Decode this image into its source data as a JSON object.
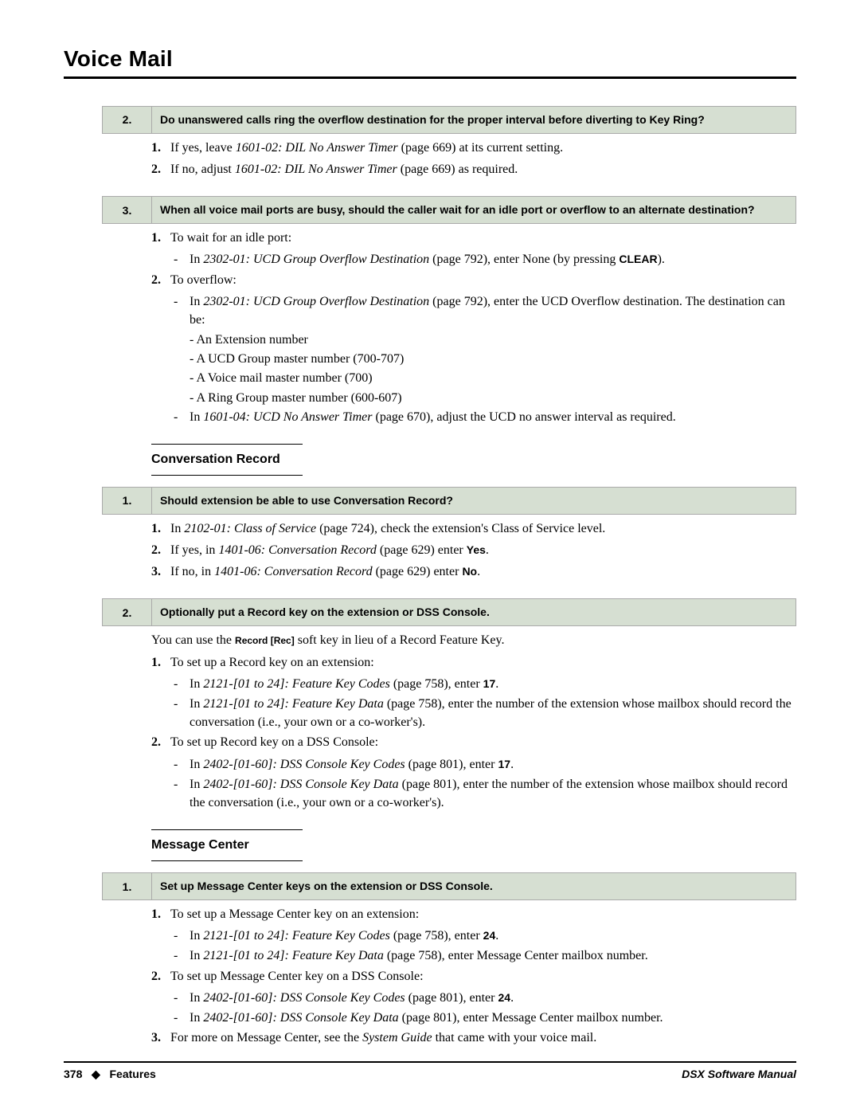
{
  "title": "Voice Mail",
  "q2": {
    "num": "2.",
    "text": "Do unanswered calls ring the overflow destination for the proper interval before diverting to Key Ring?",
    "a1num": "1.",
    "a1a": "If yes, leave ",
    "a1b": "1601-02: DIL No Answer Timer",
    "a1c": " (page 669) at its current setting.",
    "a2num": "2.",
    "a2a": "If no, adjust ",
    "a2b": "1601-02: DIL No Answer Timer",
    "a2c": " (page 669) as required."
  },
  "q3": {
    "num": "3.",
    "text": "When all voice mail ports are busy, should the caller wait for an idle port or overflow to an alternate destination?",
    "a1num": "1.",
    "a1": "To wait for an idle port:",
    "a1s1a": "In ",
    "a1s1b": "2302-01: UCD Group Overflow Destination",
    "a1s1c": " (page 792), enter None (by pressing ",
    "a1s1d": "CLEAR",
    "a1s1e": ").",
    "a2num": "2.",
    "a2": "To overflow:",
    "a2s1a": "In ",
    "a2s1b": "2302-01: UCD Group Overflow Destination",
    "a2s1c": " (page 792), enter the UCD Overflow destination. The destination can be:",
    "a2s1_1": "- An Extension number",
    "a2s1_2": "- A UCD Group master number (700-707)",
    "a2s1_3": "- A Voice mail master number (700)",
    "a2s1_4": "- A Ring Group master number (600-607)",
    "a2s2a": "In ",
    "a2s2b": "1601-04: UCD No Answer Timer",
    "a2s2c": " (page 670), adjust the UCD no answer interval as required."
  },
  "sec1": {
    "title": "Conversation Record"
  },
  "cr1": {
    "num": "1.",
    "text": "Should extension be able to use Conversation Record?",
    "a1num": "1.",
    "a1a": "In ",
    "a1b": "2102-01: Class of Service",
    "a1c": " (page 724), check the extension's Class of Service level.",
    "a2num": "2.",
    "a2a": "If yes, in ",
    "a2b": "1401-06: Conversation Record",
    "a2c": " (page 629) enter ",
    "a2d": "Yes",
    "a2e": ".",
    "a3num": "3.",
    "a3a": "If no, in ",
    "a3b": "1401-06: Conversation Record",
    "a3c": " (page 629) enter ",
    "a3d": "No",
    "a3e": "."
  },
  "cr2": {
    "num": "2.",
    "text": "Optionally put a Record key on the extension or DSS Console.",
    "introa": "You can use the ",
    "introb": "Record [Rec]",
    "introc": " soft key in lieu of a Record Feature Key.",
    "a1num": "1.",
    "a1": "To set up a Record key on an extension:",
    "a1s1a": "In ",
    "a1s1b": "2121-[01 to 24]: Feature Key Codes",
    "a1s1c": " (page 758), enter ",
    "a1s1d": "17",
    "a1s1e": ".",
    "a1s2a": "In ",
    "a1s2b": "2121-[01 to 24]: Feature Key Data",
    "a1s2c": " (page 758), enter the number of the extension whose mailbox should record the conversation (i.e., your own or a co-worker's).",
    "a2num": "2.",
    "a2": "To set up Record key on a DSS Console:",
    "a2s1a": "In ",
    "a2s1b": "2402-[01-60]: DSS Console Key Codes",
    "a2s1c": " (page 801), enter ",
    "a2s1d": "17",
    "a2s1e": ".",
    "a2s2a": "In ",
    "a2s2b": "2402-[01-60]: DSS Console Key Data",
    "a2s2c": " (page 801), enter the number of the extension whose mailbox should record the conversation (i.e., your own or a co-worker's)."
  },
  "sec2": {
    "title": "Message Center"
  },
  "mc1": {
    "num": "1.",
    "text": "Set up Message Center keys on the extension or DSS Console.",
    "a1num": "1.",
    "a1": "To set up a Message Center key on an extension:",
    "a1s1a": "In ",
    "a1s1b": "2121-[01 to 24]: Feature Key Codes",
    "a1s1c": " (page 758), enter ",
    "a1s1d": "24",
    "a1s1e": ".",
    "a1s2a": "In ",
    "a1s2b": "2121-[01 to 24]: Feature Key Data",
    "a1s2c": " (page 758), enter Message Center mailbox number.",
    "a2num": "2.",
    "a2": "To set up Message Center key on a DSS Console:",
    "a2s1a": "In ",
    "a2s1b": "2402-[01-60]: DSS Console Key Codes",
    "a2s1c": " (page 801), enter ",
    "a2s1d": "24",
    "a2s1e": ".",
    "a2s2a": "In ",
    "a2s2b": "2402-[01-60]: DSS Console Key Data",
    "a2s2c": " (page 801), enter Message Center mailbox number.",
    "a3num": "3.",
    "a3a": "For more on Message Center, see the ",
    "a3b": "System Guide",
    "a3c": " that came with your voice mail."
  },
  "footer": {
    "left_page": "378",
    "left_sep": "◆",
    "left_text": "Features",
    "right": "DSX Software Manual"
  }
}
